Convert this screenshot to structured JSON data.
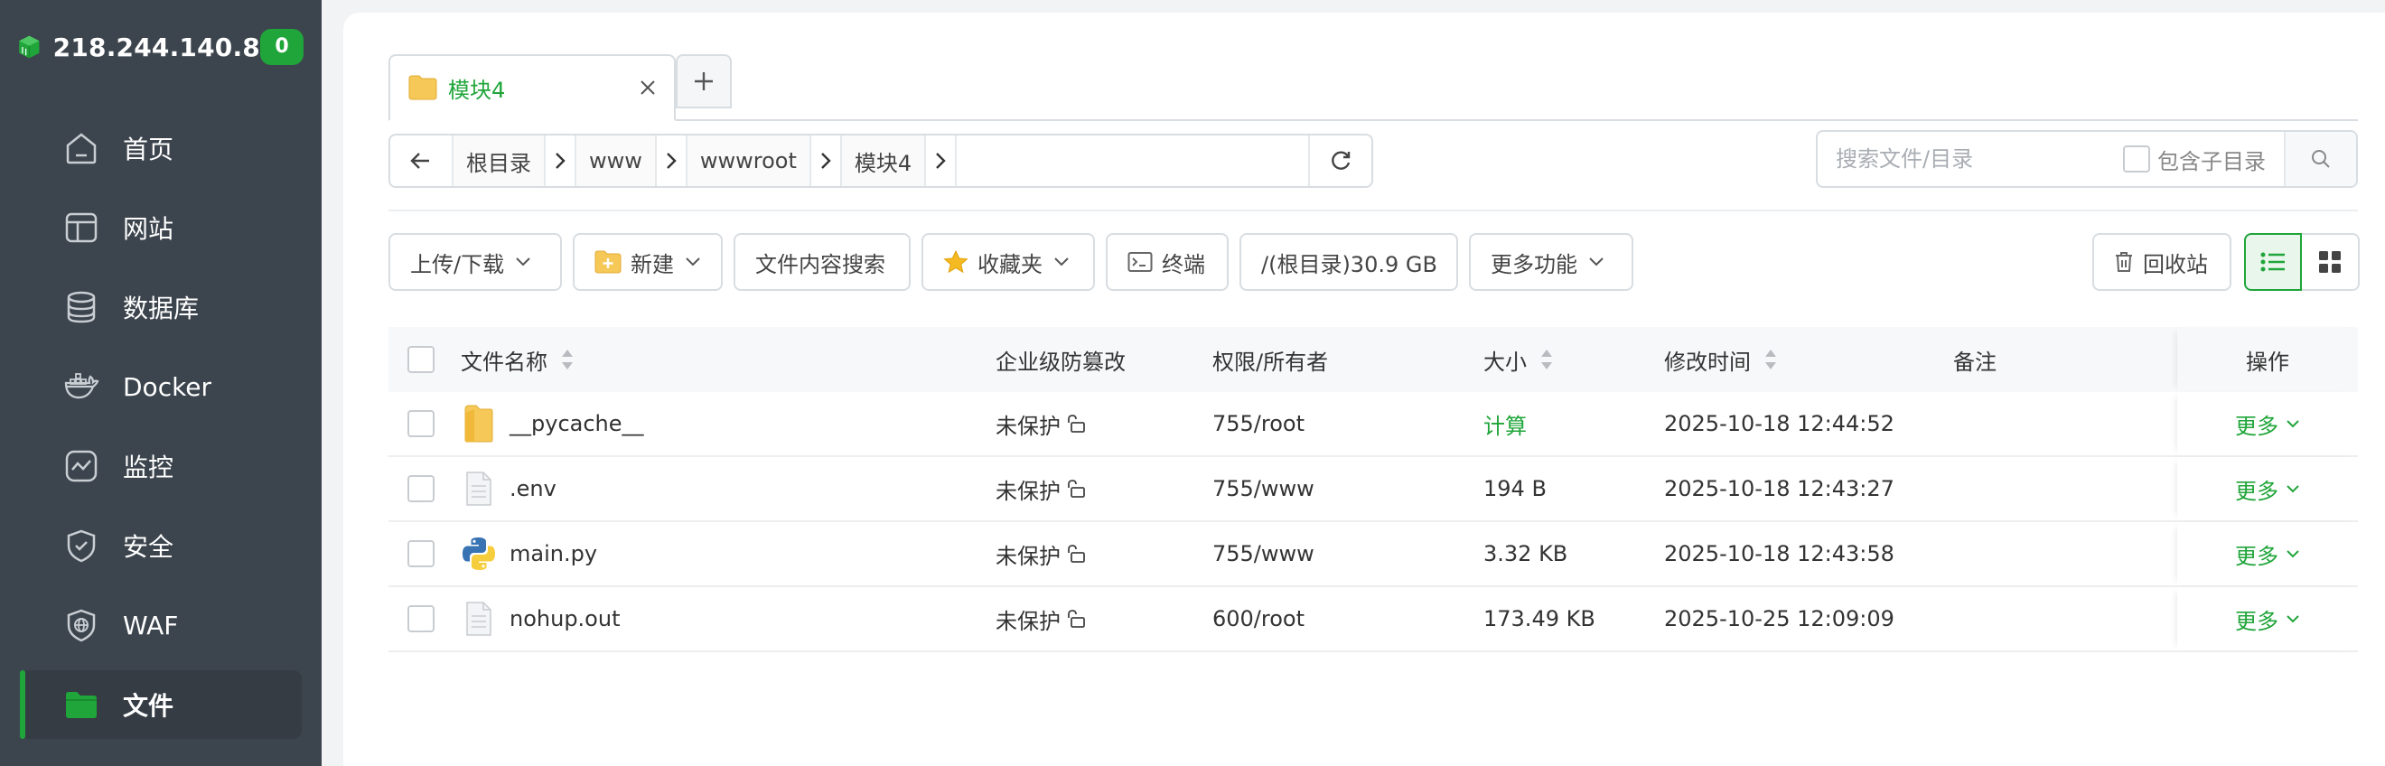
{
  "sidebar": {
    "ip": "218.244.140.8",
    "badge": "0",
    "items": [
      {
        "label": "首页",
        "icon": "home-icon"
      },
      {
        "label": "网站",
        "icon": "website-icon"
      },
      {
        "label": "数据库",
        "icon": "database-icon"
      },
      {
        "label": "Docker",
        "icon": "docker-icon"
      },
      {
        "label": "监控",
        "icon": "monitor-icon"
      },
      {
        "label": "安全",
        "icon": "shield-icon"
      },
      {
        "label": "WAF",
        "icon": "waf-icon"
      },
      {
        "label": "文件",
        "icon": "folder-icon",
        "active": true
      }
    ]
  },
  "tabs": [
    {
      "label": "模块4"
    }
  ],
  "path": {
    "crumbs": [
      "根目录",
      "www",
      "wwwroot",
      "模块4"
    ]
  },
  "search": {
    "placeholder": "搜索文件/目录",
    "include_sub_label": "包含子目录"
  },
  "toolbar": {
    "upload_download": "上传/下载",
    "new": "新建",
    "content_search": "文件内容搜索",
    "favorites": "收藏夹",
    "terminal": "终端",
    "disk": "/(根目录)30.9 GB",
    "more_functions": "更多功能",
    "recycle_bin": "回收站"
  },
  "table": {
    "headers": {
      "name": "文件名称",
      "protection": "企业级防篡改",
      "permission": "权限/所有者",
      "size": "大小",
      "modified": "修改时间",
      "note": "备注",
      "actions": "操作"
    },
    "rows": [
      {
        "name": "__pycache__",
        "type": "folder",
        "protection": "未保护",
        "permission": "755/root",
        "size": "计算",
        "modified": "2025-10-18 12:44:52",
        "note": "",
        "action": "更多"
      },
      {
        "name": ".env",
        "type": "file",
        "protection": "未保护",
        "permission": "755/www",
        "size": "194 B",
        "modified": "2025-10-18 12:43:27",
        "note": "",
        "action": "更多"
      },
      {
        "name": "main.py",
        "type": "python",
        "protection": "未保护",
        "permission": "755/www",
        "size": "3.32 KB",
        "modified": "2025-10-18 12:43:58",
        "note": "",
        "action": "更多"
      },
      {
        "name": "nohup.out",
        "type": "file",
        "protection": "未保护",
        "permission": "600/root",
        "size": "173.49 KB",
        "modified": "2025-10-25 12:09:09",
        "note": "",
        "action": "更多"
      }
    ]
  },
  "colors": {
    "accent": "#20a53a",
    "sidebar": "#3c444d"
  }
}
